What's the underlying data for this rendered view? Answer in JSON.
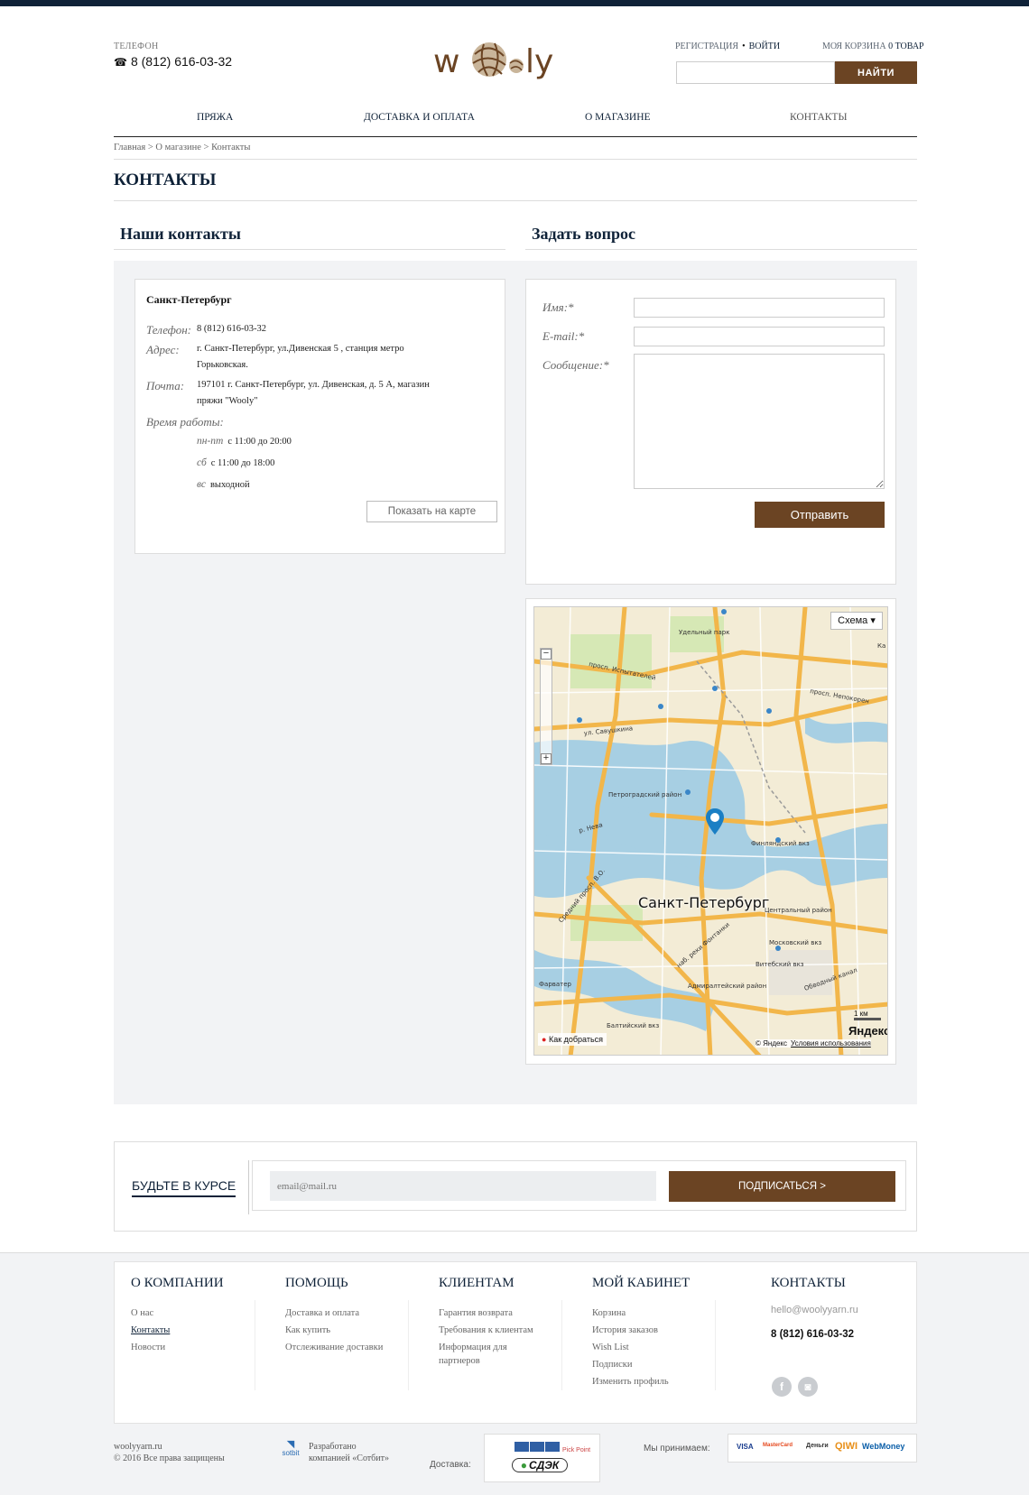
{
  "header": {
    "phone_label": "ТЕЛЕФОН",
    "phone": "8 (812) 616-03-32",
    "phone_icon": "phone-icon",
    "logo_text_1": "w",
    "logo_text_2": "ly",
    "register": "РЕГИСТРАЦИЯ",
    "login": "ВОЙТИ",
    "cart_label": "МОЯ КОРЗИНА",
    "cart_count": "0 ТОВАР",
    "search_placeholder": "",
    "search_button": "НАЙТИ"
  },
  "nav": [
    "ПРЯЖА",
    "ДОСТАВКА И ОПЛАТА",
    "О МАГАЗИНЕ",
    "КОНТАКТЫ"
  ],
  "breadcrumb": {
    "home": "Главная",
    "about": "О магазине",
    "current": "Контакты",
    "sep": ">"
  },
  "page_title": "КОНТАКТЫ",
  "contacts": {
    "section_title": "Наши контакты",
    "city": "Санкт-Петербург",
    "phone_label": "Телефон:",
    "phone_value": "8 (812) 616-03-32",
    "address_label": "Адрес:",
    "address_value": "г. Санкт-Петербург, ул.Дивенская 5 , станция метро Горьковская.",
    "mail_label": "Почта:",
    "mail_value": "197101 г. Санкт-Петербург, ул. Дивенская, д. 5 А, магазин пряжи \"Wooly\"",
    "hours_label": "Время работы:",
    "hours": [
      {
        "day": "пн-пт",
        "time": "с 11:00 до 20:00"
      },
      {
        "day": "сб",
        "time": "с 11:00 до 18:00"
      },
      {
        "day": "вс",
        "time": "выходной"
      }
    ],
    "map_button": "Показать на карте"
  },
  "question": {
    "section_title": "Задать вопрос",
    "name_label": "Имя:*",
    "email_label": "E-mail:*",
    "message_label": "Сообщение:*",
    "submit": "Отправить"
  },
  "map": {
    "type_button": "Схема ▾",
    "city_label": "Санкт-Петербург",
    "route": "Как добраться",
    "copyright": "© Яндекс",
    "terms": "Условия использования",
    "brand": "Яндекс",
    "scale": "1 км",
    "labels": [
      "просп. Испытателей",
      "ул. Савушкина",
      "просп. Непокорен",
      "Удельный парк",
      "Петроградский район",
      "Финляндский вкз",
      "Центральный район",
      "Московский вкз",
      "Витебский вкз",
      "Адмиралтейский район",
      "Балтийский вкз",
      "р. Нева",
      "Средний просп. В.О.",
      "наб. реки Фонтанки",
      "Фарватер",
      "Обводный канал",
      "Ка"
    ],
    "zoom_in": "+",
    "zoom_out": "−"
  },
  "subscribe": {
    "title": "БУДЬТЕ В КУРСЕ",
    "placeholder": "email@mail.ru",
    "button": "ПОДПИСАТЬСЯ >"
  },
  "footer": {
    "columns": [
      {
        "title": "О КОМПАНИИ",
        "links": [
          "О нас",
          "Контакты",
          "Новости"
        ]
      },
      {
        "title": "ПОМОЩЬ",
        "links": [
          "Доставка и оплата",
          "Как купить",
          "Отслеживание доставки"
        ]
      },
      {
        "title": "КЛИЕНТАМ",
        "links": [
          "Гарантия возврата",
          "Требования к клиентам",
          "Информация для партнеров"
        ]
      },
      {
        "title": "МОЙ КАБИНЕТ",
        "links": [
          "Корзина",
          "История заказов",
          "Wish List",
          "Подписки",
          "Изменить профиль"
        ]
      }
    ],
    "contacts_title": "КОНТАКТЫ",
    "email": "hello@woolyyarn.ru",
    "phone": "8 (812) 616-03-32",
    "social": [
      {
        "name": "facebook-icon",
        "glyph": "f"
      },
      {
        "name": "instagram-icon",
        "glyph": "◙"
      }
    ],
    "site": "woolyyarn.ru",
    "rights": "© 2016 Все права защищены",
    "sotbit": "sotbit",
    "developed_1": "Разработано",
    "developed_2": "компанией «Сотбит»",
    "delivery_label": "Доставка:",
    "cdek": "СДЭК",
    "pickpoint": "Pick Point",
    "payment_label": "Мы принимаем:",
    "payments": [
      "VISA",
      "MasterCard",
      "Деньги",
      "QIWI",
      "WebMoney"
    ]
  },
  "colors": {
    "brand_brown": "#6b4423",
    "navy": "#0f2238"
  }
}
